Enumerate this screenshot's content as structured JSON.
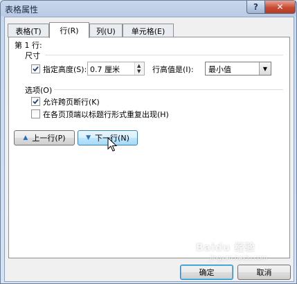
{
  "window": {
    "title": "表格属性",
    "help_label": "?",
    "close_label": "✕"
  },
  "tabs": [
    {
      "label": "表格(T)",
      "active": false
    },
    {
      "label": "行(R)",
      "active": true
    },
    {
      "label": "列(U)",
      "active": false
    },
    {
      "label": "单元格(E)",
      "active": false
    }
  ],
  "row_tab": {
    "row_heading": "第 1 行:",
    "size_group": "尺寸",
    "specify_height_label": "指定高度(S):",
    "specify_height_checked": true,
    "height_value": "0.7 厘米",
    "row_height_is_label": "行高值是(I):",
    "row_height_mode": "最小值",
    "options_group": "选项(O)",
    "allow_break_label": "允许跨页断行(K)",
    "allow_break_checked": true,
    "repeat_header_label": "在各页顶端以标题行形式重复出现(H)",
    "repeat_header_checked": false,
    "prev_row_label": "上一行(P)",
    "next_row_label": "下一行(N)"
  },
  "footer": {
    "ok_label": "确定",
    "cancel_label": "取消"
  },
  "watermark": "Baidu 经验",
  "watermark_url": "jingyan.baidu.com"
}
